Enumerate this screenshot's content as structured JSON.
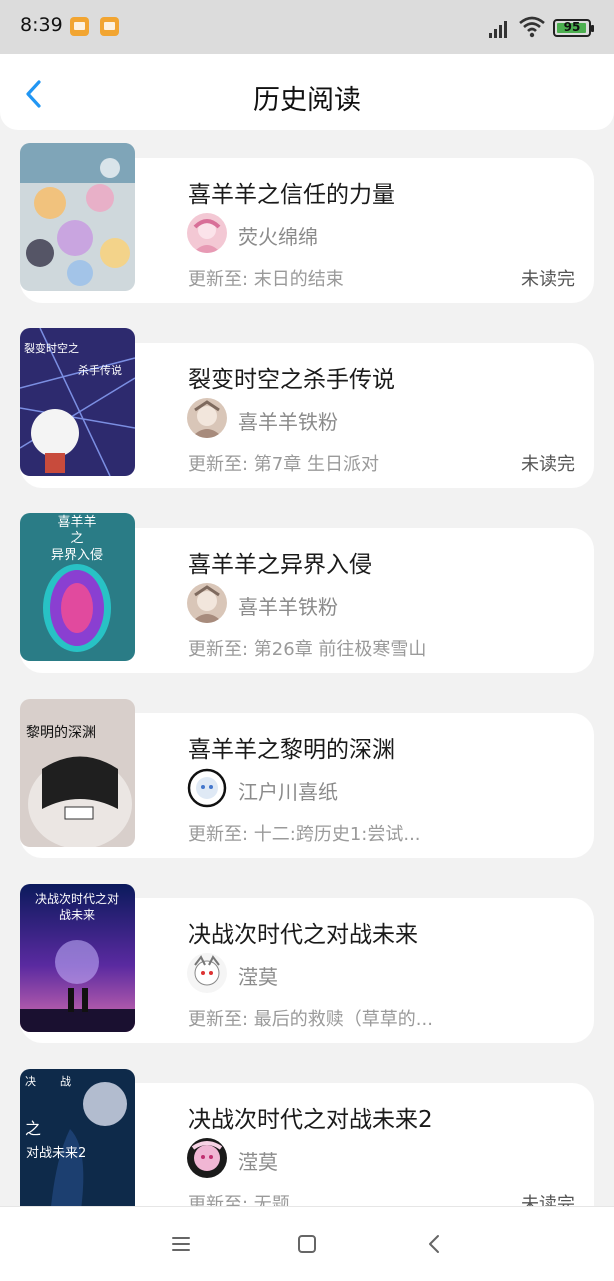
{
  "status_bar": {
    "time": "8:39",
    "battery": "95",
    "battery_level_percent": 95,
    "icons": [
      "notification-icon",
      "notification-icon",
      "signal-icon",
      "wifi-icon",
      "battery-icon"
    ]
  },
  "header": {
    "title": "历史阅读",
    "back_icon": "chevron-left-icon"
  },
  "colors": {
    "accent": "#2196f3",
    "background": "#f2f2f2",
    "card": "#ffffff",
    "title_text": "#1a1a1a",
    "secondary_text": "#8b8b8b",
    "notification": "#f2a531",
    "battery": "#4caf50"
  },
  "books": [
    {
      "title": "喜羊羊之信任的力量",
      "author": "荧火绵绵",
      "update": "更新至: 末日的结束",
      "status": "未读完"
    },
    {
      "title": "裂变时空之杀手传说",
      "author": "喜羊羊铁粉",
      "update": "更新至: 第7章 生日派对",
      "status": "未读完",
      "cover_text": [
        "裂变时空之",
        "杀手传说"
      ]
    },
    {
      "title": "喜羊羊之异界入侵",
      "author": "喜羊羊铁粉",
      "update": "更新至: 第26章 前往极寒雪山",
      "status": "",
      "cover_text": [
        "喜羊羊",
        "之",
        "异界入侵"
      ]
    },
    {
      "title": "喜羊羊之黎明的深渊",
      "author": "江户川喜纸",
      "update": "更新至: 十二:跨历史1:尝试...",
      "status": "",
      "cover_text": [
        "黎明的深渊"
      ]
    },
    {
      "title": "决战次时代之对战未来",
      "author": "滢莫",
      "update": "更新至: 最后的救赎（草草的...",
      "status": "",
      "cover_text": [
        "决战次时代之对",
        "战未来"
      ]
    },
    {
      "title": "决战次时代之对战未来2",
      "author": "滢莫",
      "update": "更新至: 无题",
      "status": "未读完",
      "cover_text": [
        "决",
        "战",
        "之",
        "对战未来2"
      ]
    }
  ],
  "nav_bar": {
    "icons": [
      "menu-icon",
      "home-icon",
      "back-icon"
    ]
  }
}
